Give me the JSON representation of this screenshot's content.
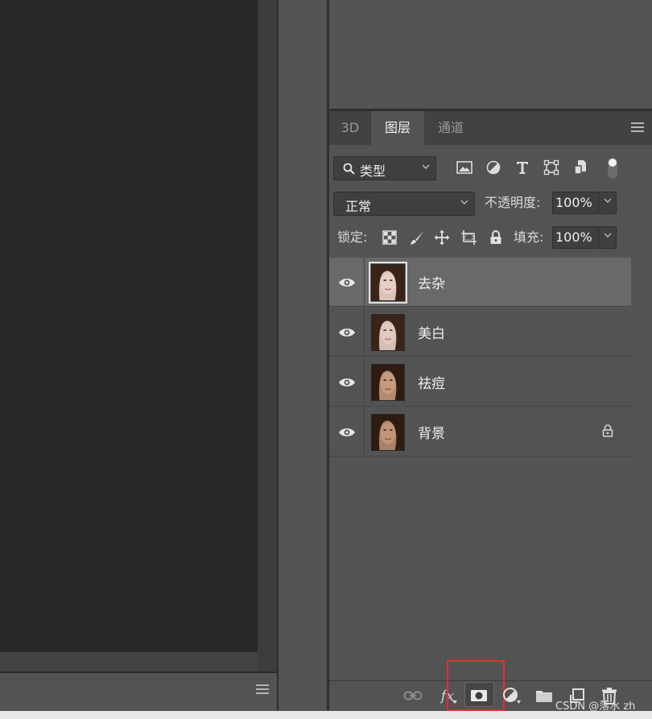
{
  "tabs": [
    {
      "label": "3D",
      "active": false
    },
    {
      "label": "图层",
      "active": true
    },
    {
      "label": "通道",
      "active": false
    }
  ],
  "filter": {
    "label": "类型"
  },
  "blend": {
    "mode": "正常",
    "opacity_label": "不透明度:",
    "opacity_value": "100%",
    "lock_label": "锁定:",
    "fill_label": "填充:",
    "fill_value": "100%"
  },
  "layers": [
    {
      "name": "去杂",
      "visible": true,
      "selected": true,
      "locked": false
    },
    {
      "name": "美白",
      "visible": true,
      "selected": false,
      "locked": false
    },
    {
      "name": "祛痘",
      "visible": true,
      "selected": false,
      "locked": false
    },
    {
      "name": "背景",
      "visible": true,
      "selected": false,
      "locked": true
    }
  ],
  "bottom_icons": [
    "link-icon",
    "fx-icon",
    "layer-mask-icon",
    "adjustment-icon",
    "folder-icon",
    "new-layer-icon",
    "trash-icon"
  ],
  "fx_label": "fx",
  "watermark": "CSDN @落水 zh",
  "colors": {
    "highlight": "#e52e2e",
    "panel": "#535353",
    "selected_row": "#696969"
  }
}
